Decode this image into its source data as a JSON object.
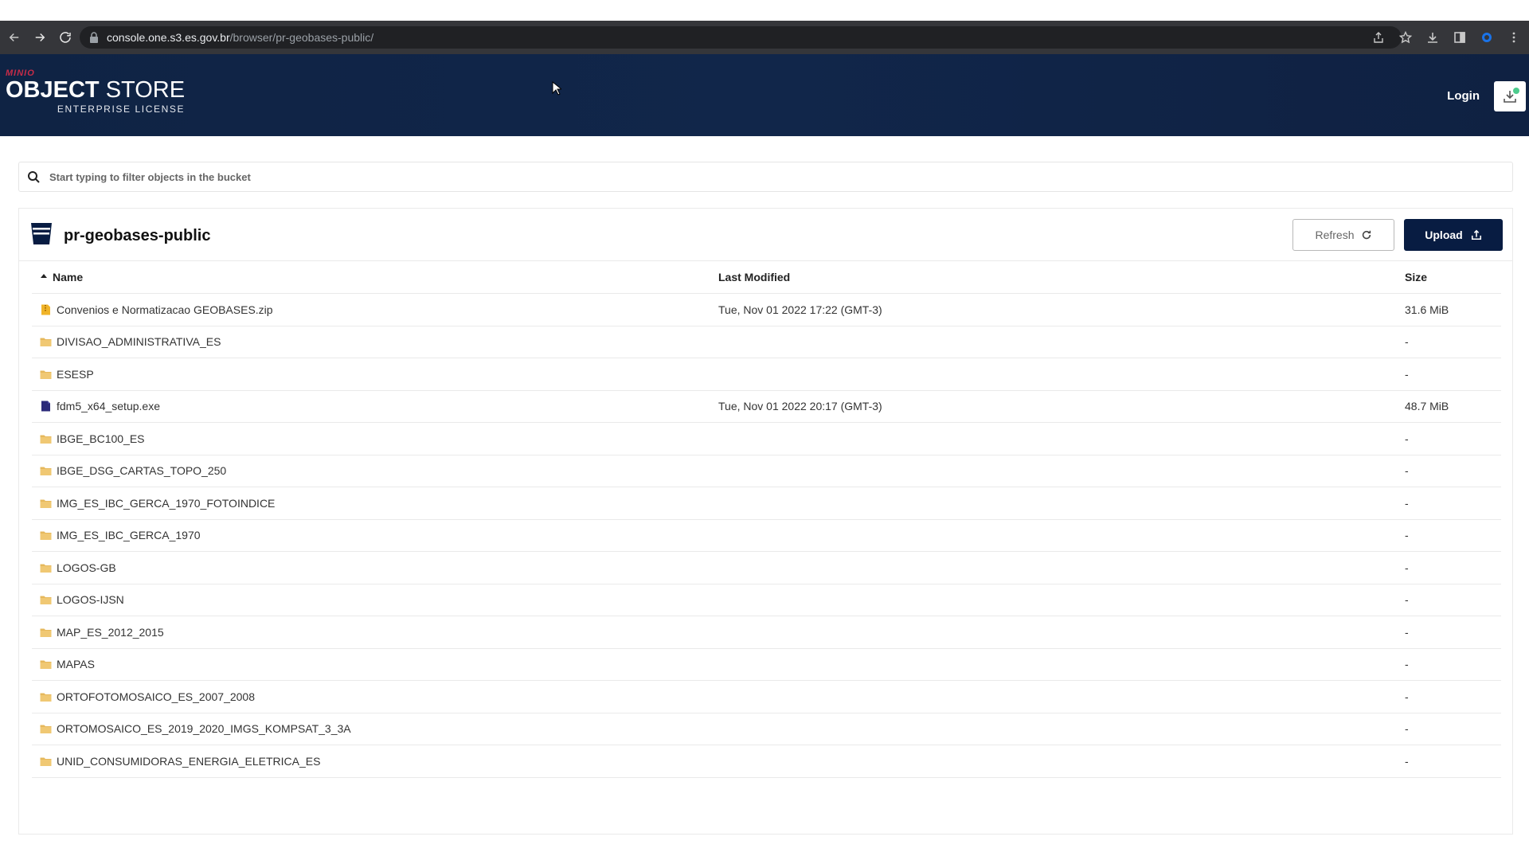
{
  "browser": {
    "url_host": "console.one.s3.es.gov.br",
    "url_path": "/browser/pr-geobases-public/"
  },
  "header": {
    "brand_small": "MINIO",
    "brand_bold": "OBJECT",
    "brand_light": " STORE",
    "license": "ENTERPRISE LICENSE",
    "login_label": "Login"
  },
  "search": {
    "placeholder": "Start typing to filter objects in the bucket"
  },
  "bucket": {
    "name": "pr-geobases-public",
    "refresh_label": "Refresh",
    "upload_label": "Upload"
  },
  "table": {
    "columns": {
      "name": "Name",
      "modified": "Last Modified",
      "size": "Size"
    },
    "rows": [
      {
        "name": "Convenios e Normatizacao GEOBASES.zip",
        "modified": "Tue, Nov 01 2022 17:22 (GMT-3)",
        "size": "31.6 MiB",
        "icon": "zip-file-icon"
      },
      {
        "name": "DIVISAO_ADMINISTRATIVA_ES",
        "modified": "",
        "size": "-",
        "icon": "folder-icon"
      },
      {
        "name": "ESESP",
        "modified": "",
        "size": "-",
        "icon": "folder-icon"
      },
      {
        "name": "fdm5_x64_setup.exe",
        "modified": "Tue, Nov 01 2022 20:17 (GMT-3)",
        "size": "48.7 MiB",
        "icon": "file-icon"
      },
      {
        "name": "IBGE_BC100_ES",
        "modified": "",
        "size": "-",
        "icon": "folder-icon"
      },
      {
        "name": "IBGE_DSG_CARTAS_TOPO_250",
        "modified": "",
        "size": "-",
        "icon": "folder-icon"
      },
      {
        "name": "IMG_ES_IBC_GERCA_1970_FOTOINDICE",
        "modified": "",
        "size": "-",
        "icon": "folder-icon"
      },
      {
        "name": "IMG_ES_IBC_GERCA_1970",
        "modified": "",
        "size": "-",
        "icon": "folder-icon"
      },
      {
        "name": "LOGOS-GB",
        "modified": "",
        "size": "-",
        "icon": "folder-icon"
      },
      {
        "name": "LOGOS-IJSN",
        "modified": "",
        "size": "-",
        "icon": "folder-icon"
      },
      {
        "name": "MAP_ES_2012_2015",
        "modified": "",
        "size": "-",
        "icon": "folder-icon"
      },
      {
        "name": "MAPAS",
        "modified": "",
        "size": "-",
        "icon": "folder-icon"
      },
      {
        "name": "ORTOFOTOMOSAICO_ES_2007_2008",
        "modified": "",
        "size": "-",
        "icon": "folder-icon"
      },
      {
        "name": "ORTOMOSAICO_ES_2019_2020_IMGS_KOMPSAT_3_3A",
        "modified": "",
        "size": "-",
        "icon": "folder-icon"
      },
      {
        "name": "UNID_CONSUMIDORAS_ENERGIA_ELETRICA_ES",
        "modified": "",
        "size": "-",
        "icon": "folder-icon"
      }
    ]
  },
  "colors": {
    "header_bg": "#11264a",
    "brand_red": "#c72c48",
    "upload_bg": "#081c42",
    "folder": "#e6b85c",
    "zip": "#f0b429",
    "file": "#2b2a7a"
  }
}
